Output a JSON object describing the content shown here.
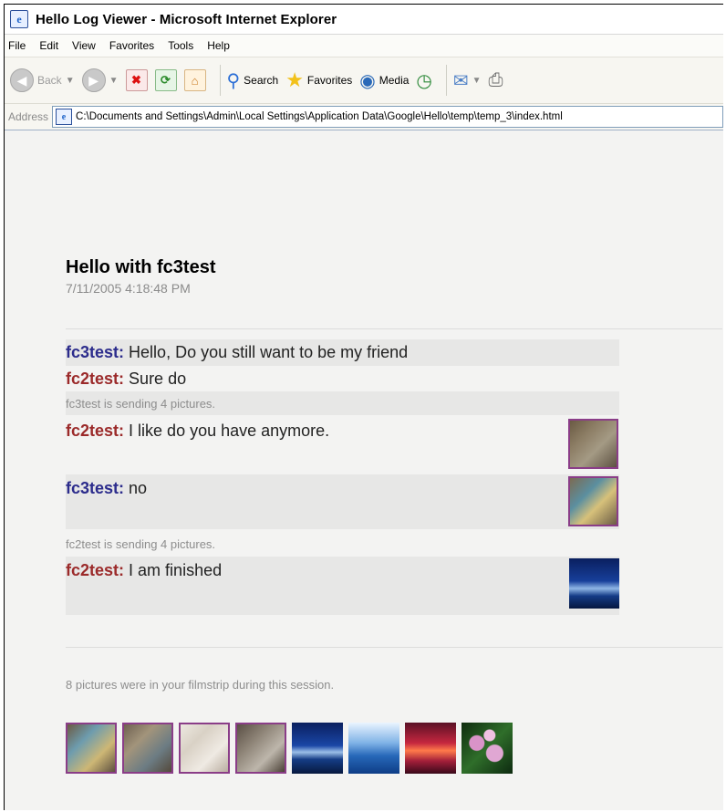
{
  "window": {
    "title": "Hello Log Viewer - Microsoft Internet Explorer"
  },
  "menu": [
    "File",
    "Edit",
    "View",
    "Favorites",
    "Tools",
    "Help"
  ],
  "toolbar": {
    "back": "Back",
    "search": "Search",
    "favorites": "Favorites",
    "media": "Media"
  },
  "address": {
    "label": "Address",
    "url": "C:\\Documents and Settings\\Admin\\Local Settings\\Application Data\\Google\\Hello\\temp\\temp_3\\index.html"
  },
  "chat": {
    "title": "Hello with fc3test",
    "date": "7/11/2005 4:18:48 PM",
    "messages": [
      {
        "sender": "fc3test:",
        "text": "Hello, Do you still want to be my friend"
      },
      {
        "sender": "fc2test:",
        "text": "Sure do"
      },
      {
        "note": "fc3test is sending 4 pictures."
      },
      {
        "sender": "fc2test:",
        "text": "I like do you have anymore."
      },
      {
        "sender": "fc3test:",
        "text": "no"
      },
      {
        "note": "fc2test is sending 4 pictures."
      },
      {
        "sender": "fc2test:",
        "text": "I am finished"
      }
    ]
  },
  "filmstrip": {
    "summary": "8 pictures were in your filmstrip during this session."
  },
  "colors": {
    "sender_blue": "#2c2c8c",
    "sender_red": "#9b2a2a",
    "selected_border": "#8a3d88"
  }
}
